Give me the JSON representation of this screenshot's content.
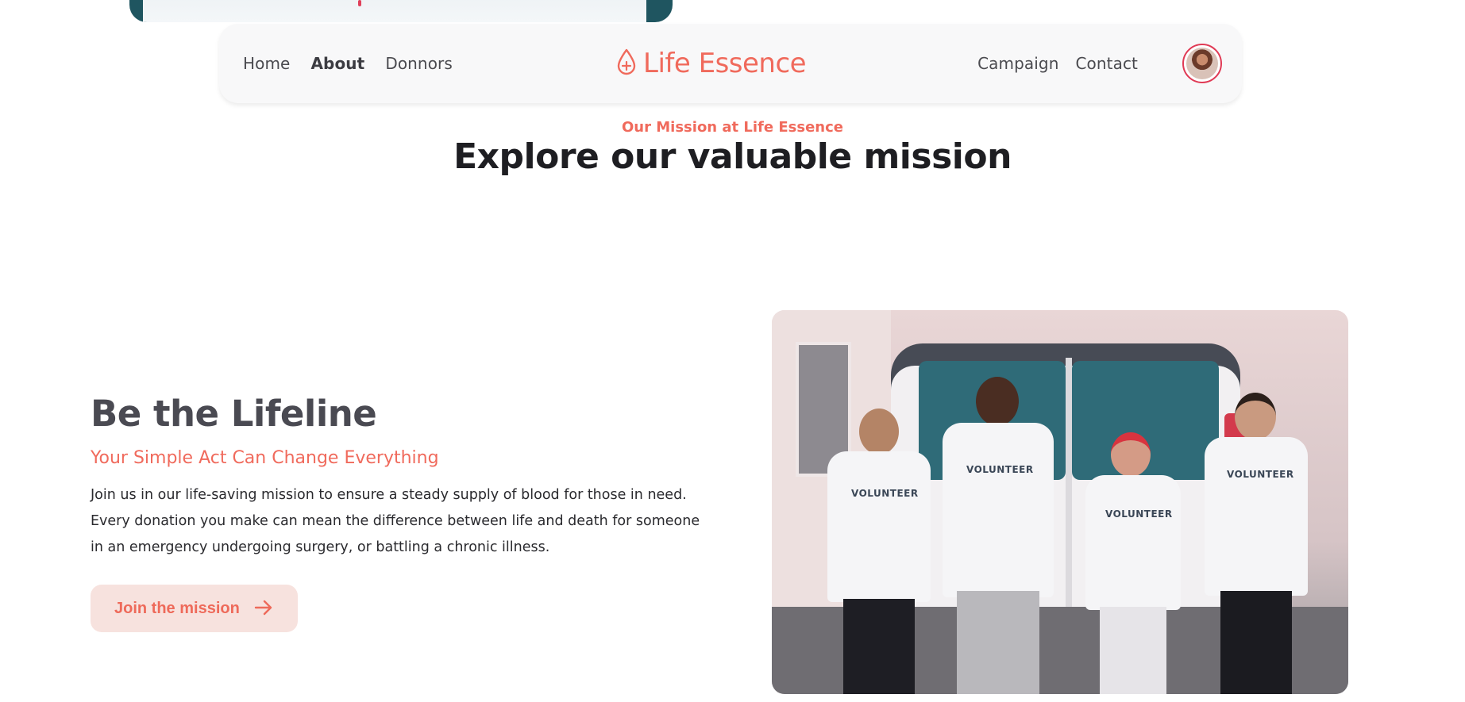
{
  "nav": {
    "left_links": [
      {
        "label": "Home",
        "active": false
      },
      {
        "label": "About",
        "active": true
      },
      {
        "label": "Donnors",
        "active": false
      }
    ],
    "brand": {
      "name": "Life Essence",
      "icon": "blood-drop-plus-icon"
    },
    "right_links": [
      {
        "label": "Campaign"
      },
      {
        "label": "Contact"
      }
    ],
    "avatar": {
      "icon": "user-avatar"
    }
  },
  "mission": {
    "eyebrow": "Our Mission at Life Essence",
    "title": "Explore our valuable mission"
  },
  "feature": {
    "heading": "Be the Lifeline",
    "subheading": "Your Simple Act Can Change Everything",
    "body": "Join us in our life-saving mission to ensure a steady supply of blood for those in need. Every donation you make can mean the difference between life and death for someone in an emergency undergoing surgery, or battling a chronic illness.",
    "cta_label": "Join the mission",
    "cta_icon": "arrow-right-icon"
  },
  "photo": {
    "shirt_text": "VOLUNTEER"
  },
  "colors": {
    "accent": "#f06a5c",
    "nav_bg": "#f8f8f9",
    "cta_bg": "#f7e2de",
    "avatar_ring": "#e03a55"
  }
}
